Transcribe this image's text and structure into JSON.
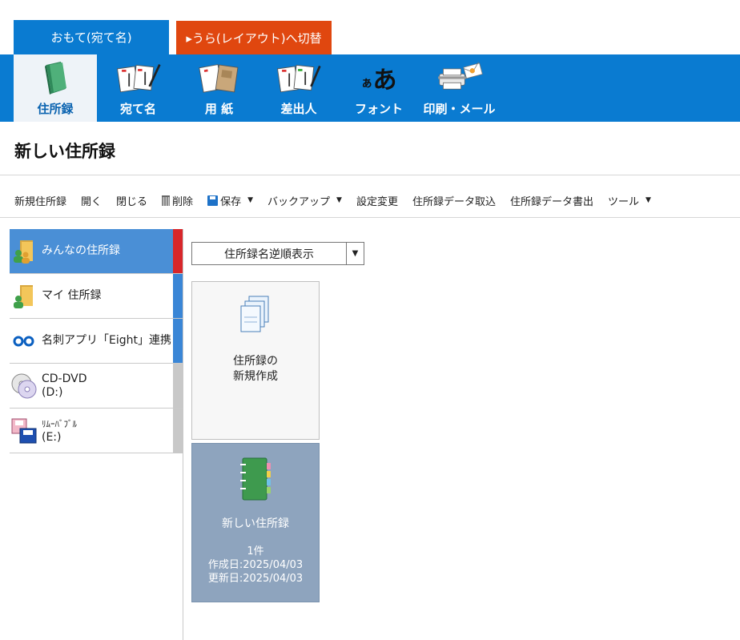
{
  "tabs": {
    "front": "おもて(宛て名)",
    "back": "▸うら(レイアウト)へ切替"
  },
  "ribbon": {
    "items": [
      {
        "label": "住所録",
        "icon": "address-book-icon"
      },
      {
        "label": "宛て名",
        "icon": "postcard-pen-icon"
      },
      {
        "label": "用 紙",
        "icon": "paper-icon"
      },
      {
        "label": "差出人",
        "icon": "sender-postcard-icon"
      },
      {
        "label": "フォント",
        "icon": "font-a-icon"
      },
      {
        "label": "印刷・メール",
        "icon": "printer-mail-icon"
      }
    ],
    "font_glyph_small": "ぁ",
    "font_glyph_big": "あ"
  },
  "page": {
    "title": "新しい住所録"
  },
  "toolbar": {
    "new": "新規住所録",
    "open": "開く",
    "close": "閉じる",
    "delete": "削除",
    "save": "保存",
    "backup": "バックアップ",
    "settings": "設定変更",
    "import": "住所録データ取込",
    "export": "住所録データ書出",
    "tools": "ツール",
    "caret": "▼"
  },
  "sidebar": {
    "items": [
      {
        "label": "みんなの住所録",
        "icon": "shared-folder-icon"
      },
      {
        "label": "マイ 住所録",
        "icon": "my-folder-icon"
      },
      {
        "label": "名刺アプリ「Eight」連携",
        "icon": "eight-logo-icon"
      },
      {
        "label": "CD-DVD",
        "sub": "(D:)",
        "icon": "cd-dvd-icon"
      },
      {
        "label": "ﾘﾑｰﾊﾞﾌﾞﾙ",
        "sub": "(E:)",
        "icon": "removable-disk-icon"
      }
    ]
  },
  "main": {
    "sort_label": "住所録名逆順表示",
    "sort_arrow": "▼",
    "new_card": {
      "line1": "住所録の",
      "line2": "新規作成"
    },
    "book_card": {
      "name": "新しい住所録",
      "count": "1件",
      "created": "作成日:2025/04/03",
      "updated": "更新日:2025/04/03"
    }
  },
  "colors": {
    "accent_blue": "#0a7bd1",
    "tab_orange": "#e0470f",
    "selected_marker_red": "#d8262a",
    "marker_blue": "#3a86d6",
    "marker_gray": "#c8c8c8",
    "card_selected": "#8ea4be"
  }
}
